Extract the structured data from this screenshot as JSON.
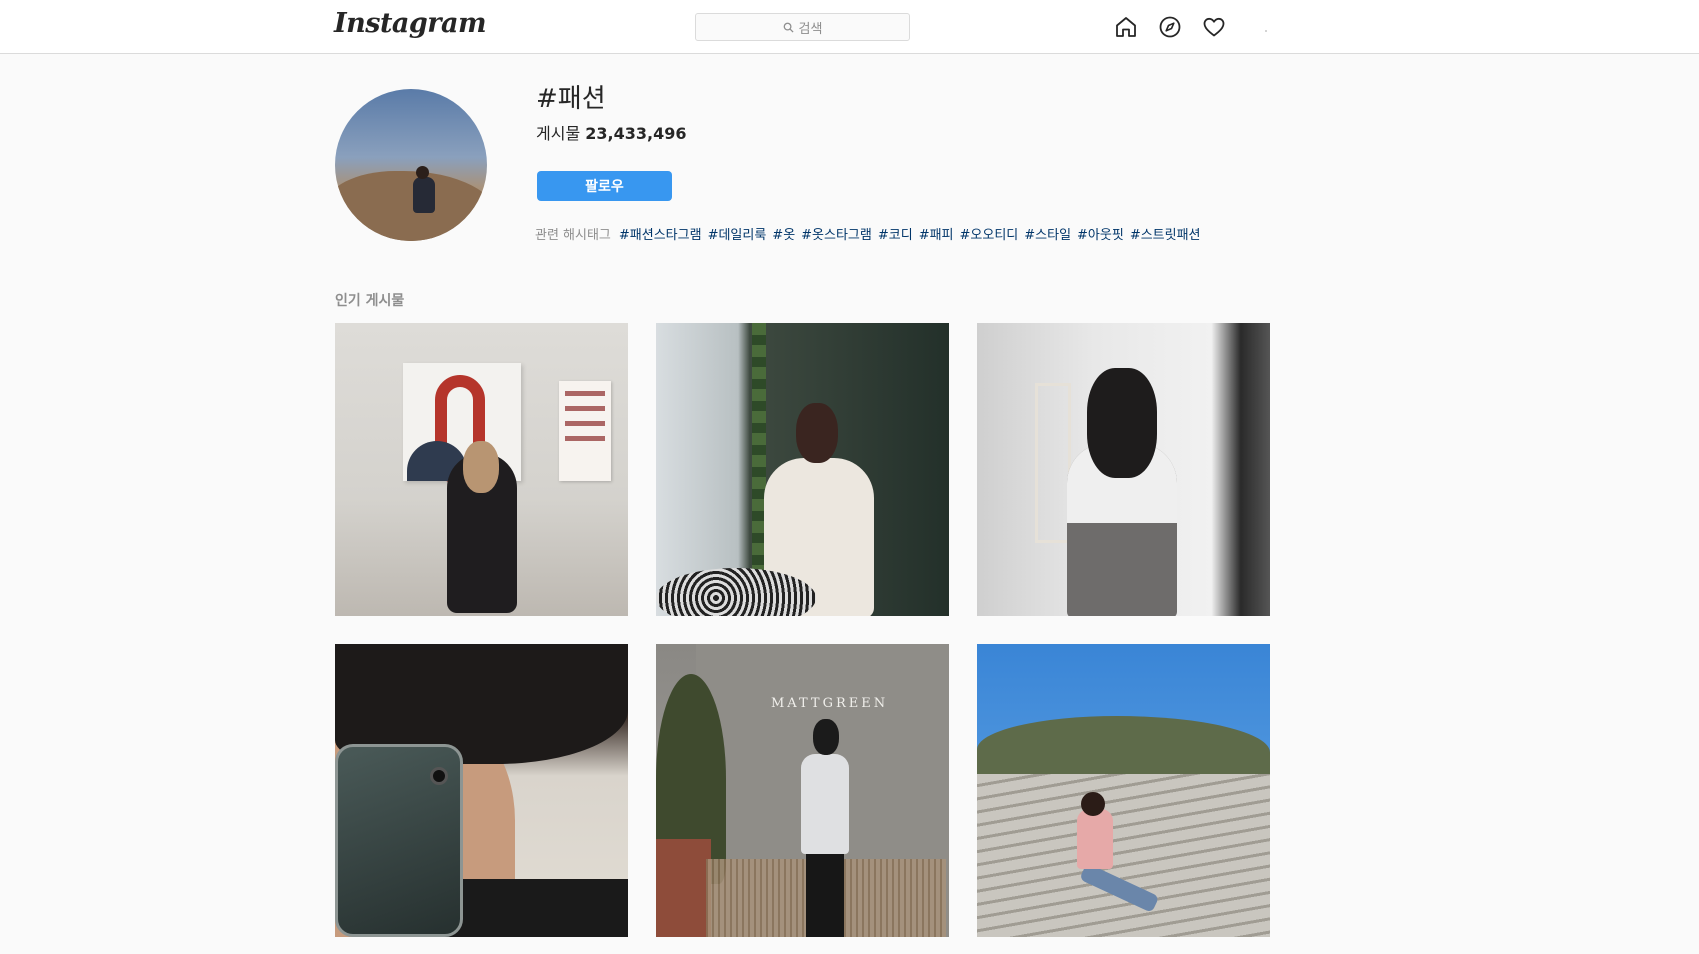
{
  "nav": {
    "logo": "Instagram",
    "search_placeholder": "검색",
    "icons": [
      "home-icon",
      "compass-icon",
      "heart-icon"
    ]
  },
  "tag": {
    "title": "#패션",
    "posts_label": "게시물",
    "posts_count": "23,433,496",
    "follow_label": "팔로우",
    "related_label": "관련 해시태그",
    "related": [
      "#패션스타그램",
      "#데일리룩",
      "#옷",
      "#옷스타그램",
      "#코디",
      "#패피",
      "#오오티디",
      "#스타일",
      "#아웃핏",
      "#스트릿패션"
    ]
  },
  "popular": {
    "label": "인기 게시물",
    "sign_text": "MATTGREEN"
  },
  "colors": {
    "accent": "#3897f0",
    "link": "#003569",
    "muted": "#8e8e8e",
    "border": "#dbdbdb"
  }
}
